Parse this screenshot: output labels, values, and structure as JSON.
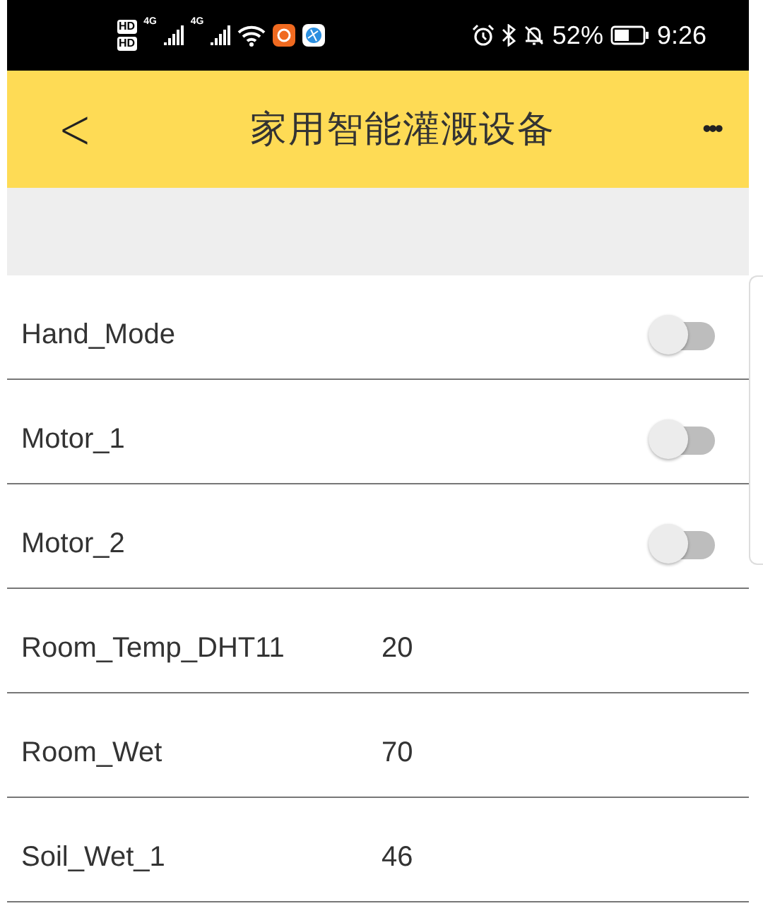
{
  "status_bar": {
    "sim_badges": [
      "HD",
      "HD"
    ],
    "networks": [
      "4G",
      "4G"
    ],
    "battery": "52%",
    "time": "9:26"
  },
  "header": {
    "back": "<",
    "title": "家用智能灌溉设备",
    "menu": "•••"
  },
  "rows": [
    {
      "kind": "switch",
      "name": "Hand_Mode",
      "on": false
    },
    {
      "kind": "switch",
      "name": "Motor_1",
      "on": false
    },
    {
      "kind": "switch",
      "name": "Motor_2",
      "on": false
    },
    {
      "kind": "value",
      "name": "Room_Temp_DHT11",
      "value": "20"
    },
    {
      "kind": "value",
      "name": "Room_Wet",
      "value": "70"
    },
    {
      "kind": "value",
      "name": "Soil_Wet_1",
      "value": "46"
    }
  ]
}
